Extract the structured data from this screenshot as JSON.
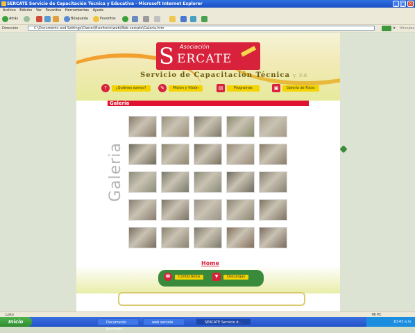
{
  "window": {
    "title": "SERCATE Servicio de Capacitación Técnica y Educativa - Microsoft Internet Explorer"
  },
  "menu": [
    "Archivo",
    "Edición",
    "Ver",
    "Favoritos",
    "Herramientas",
    "Ayuda"
  ],
  "toolbar": {
    "back_label": "Atrás",
    "search_label": "Búsqueda",
    "favorites_label": "Favoritos"
  },
  "address": {
    "label": "Dirección",
    "url": "C:\\Documents and Settings\\Owner\\Escritorio\\web\\Web sercate\\Galeria.htm",
    "go_label": "Ir",
    "links_label": "Vínculos"
  },
  "site": {
    "logo_prefix": "Asociación",
    "logo_s": "S",
    "logo_name": "ERCATE",
    "subtitle": "Servicio de Capacitación Técnica",
    "subtitle_suffix": "y Ed",
    "nav": [
      "¿Quiénes somos?",
      "Misión y Visión",
      "Programas",
      "Galería de Fotos"
    ],
    "gallery_heading": "Galeria",
    "gallery_vertical_label": "Galeria",
    "thumbs": [
      {
        "color": "#8a7a6a"
      },
      {
        "color": "#9a8f7a"
      },
      {
        "color": "#7d7868"
      },
      {
        "color": "#8a8a6c"
      },
      {
        "color": "#a59a88"
      },
      {
        "color": "#6f6a5a"
      },
      {
        "color": "#8f8670"
      },
      {
        "color": "#7a7060"
      },
      {
        "color": "#9a8a78"
      },
      {
        "color": "#8a7c68"
      },
      {
        "color": "#8c8c7a"
      },
      {
        "color": "#7a7a6a"
      },
      {
        "color": "#8a8a78"
      },
      {
        "color": "#6e6a5e"
      },
      {
        "color": "#888070"
      },
      {
        "color": "#8a7e72"
      },
      {
        "color": "#7c7466"
      },
      {
        "color": "#9a9488"
      },
      {
        "color": "#8a8472"
      },
      {
        "color": "#7e7260"
      },
      {
        "color": "#7a6e60"
      },
      {
        "color": "#8a8270"
      },
      {
        "color": "#7c786a"
      },
      {
        "color": "#846e5c"
      },
      {
        "color": "#7a6a5e"
      }
    ],
    "home_link": "Home",
    "footer_nav": [
      "Contáctenos",
      "Descargas"
    ]
  },
  "statusbar": {
    "left": "Listo",
    "right": "Mi PC"
  },
  "taskbar": {
    "start": "Inicio",
    "tasks": [
      "Documento Escritorio",
      "web sercate",
      "SERCATE Servicio d..."
    ],
    "clock": "10:43 a.m."
  },
  "colors": {
    "accent_red": "#d8223b",
    "nav_yellow": "#f4d400",
    "footer_green": "#3a8a3c"
  }
}
